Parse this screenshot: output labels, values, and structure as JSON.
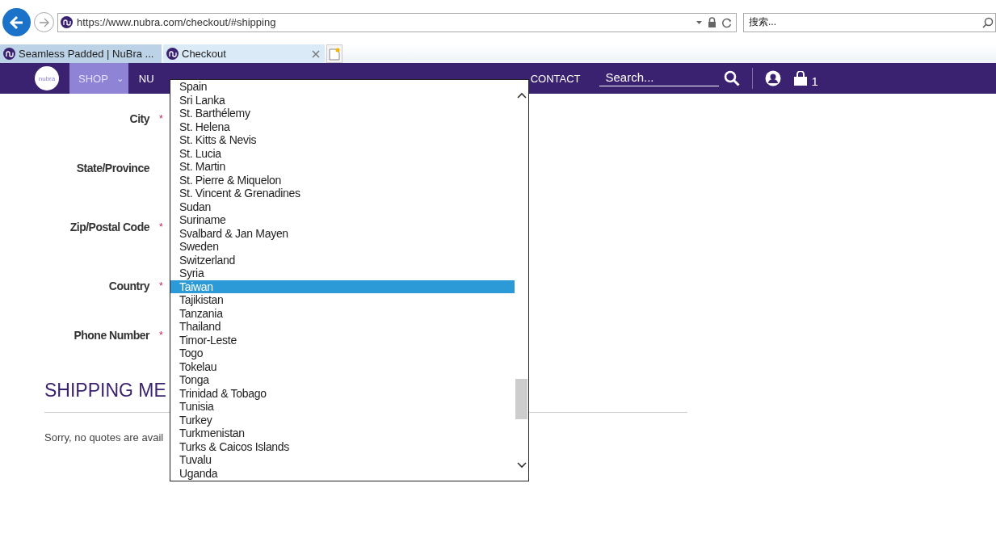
{
  "browser": {
    "address": {
      "url": "https://www.nubra.com/checkout/#shipping"
    },
    "search": {
      "placeholder": "搜索..."
    },
    "tabs": [
      {
        "title": "Seamless Padded | NuBra ...",
        "selected": false
      },
      {
        "title": "Checkout",
        "selected": true
      }
    ]
  },
  "nav": {
    "logo": "nubra",
    "items": [
      {
        "label": "SHOP",
        "selected": true,
        "caret": "⌄"
      },
      {
        "label": "NU",
        "selected": false
      },
      {
        "label": "CONTACT",
        "selected": false
      }
    ],
    "search": {
      "placeholder": "Search..."
    },
    "cart_count": "1"
  },
  "form": {
    "required_mark": "*",
    "fields": [
      {
        "label": "City",
        "required": true
      },
      {
        "label": "State/Province",
        "required": false
      },
      {
        "label": "Zip/Postal Code",
        "required": true
      },
      {
        "label": "Country",
        "required": true
      },
      {
        "label": "Phone Number",
        "required": true
      }
    ]
  },
  "shipping": {
    "heading": "SHIPPING ME",
    "message": "Sorry, no quotes are avail"
  },
  "dropdown": {
    "options": [
      {
        "label": "Spain",
        "selected": false
      },
      {
        "label": "Sri Lanka",
        "selected": false
      },
      {
        "label": "St. Barthélemy",
        "selected": false
      },
      {
        "label": "St. Helena",
        "selected": false
      },
      {
        "label": "St. Kitts & Nevis",
        "selected": false
      },
      {
        "label": "St. Lucia",
        "selected": false
      },
      {
        "label": "St. Martin",
        "selected": false
      },
      {
        "label": "St. Pierre & Miquelon",
        "selected": false
      },
      {
        "label": "St. Vincent & Grenadines",
        "selected": false
      },
      {
        "label": "Sudan",
        "selected": false
      },
      {
        "label": "Suriname",
        "selected": false
      },
      {
        "label": "Svalbard & Jan Mayen",
        "selected": false
      },
      {
        "label": "Sweden",
        "selected": false
      },
      {
        "label": "Switzerland",
        "selected": false
      },
      {
        "label": "Syria",
        "selected": false
      },
      {
        "label": "Taiwan",
        "selected": true
      },
      {
        "label": "Tajikistan",
        "selected": false
      },
      {
        "label": "Tanzania",
        "selected": false
      },
      {
        "label": "Thailand",
        "selected": false
      },
      {
        "label": "Timor-Leste",
        "selected": false
      },
      {
        "label": "Togo",
        "selected": false
      },
      {
        "label": "Tokelau",
        "selected": false
      },
      {
        "label": "Tonga",
        "selected": false
      },
      {
        "label": "Trinidad & Tobago",
        "selected": false
      },
      {
        "label": "Tunisia",
        "selected": false
      },
      {
        "label": "Turkey",
        "selected": false
      },
      {
        "label": "Turkmenistan",
        "selected": false
      },
      {
        "label": "Turks & Caicos Islands",
        "selected": false
      },
      {
        "label": "Tuvalu",
        "selected": false
      },
      {
        "label": "Uganda",
        "selected": false
      }
    ]
  }
}
